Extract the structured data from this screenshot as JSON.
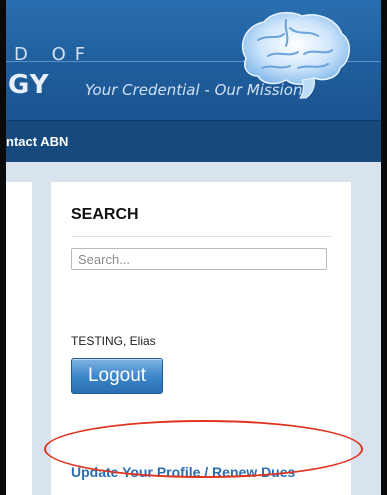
{
  "header": {
    "brand_top": "D  OF",
    "brand_main": "GY",
    "tagline": "Your Credential - Our Mission",
    "logo_icon": "brain-icon"
  },
  "nav": {
    "items": [
      {
        "label": "ntact ABN"
      }
    ]
  },
  "sidebar_widget": {
    "search_heading": "SEARCH",
    "search_placeholder": "Search...",
    "user_name": "TESTING, Elias",
    "logout_label": "Logout",
    "profile_link": "Update Your Profile / Renew Dues"
  },
  "colors": {
    "header_blue": "#1f5e9c",
    "nav_blue": "#164a7c",
    "link_blue": "#2a6db0",
    "highlight_red": "#e0341f"
  }
}
